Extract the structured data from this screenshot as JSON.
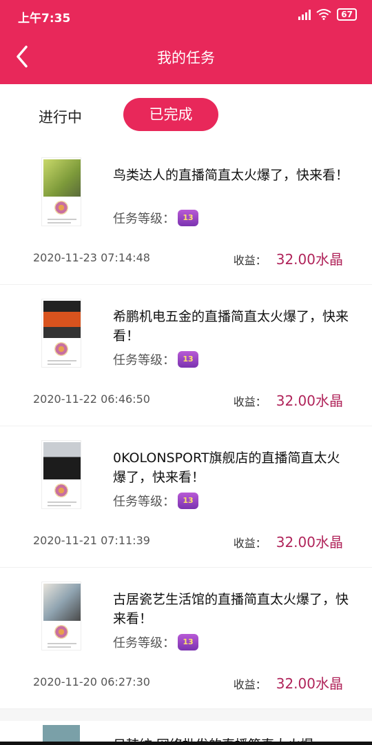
{
  "status_bar": {
    "time": "上午7:35",
    "battery": "67"
  },
  "header": {
    "title": "我的任务"
  },
  "tabs": {
    "in_progress": "进行中",
    "completed": "已完成"
  },
  "tasks": [
    {
      "title": "鸟类达人的直播简直太火爆了，快来看！",
      "level_label": "任务等级：",
      "level_badge": "13",
      "date": "2020-11-23 07:14:48",
      "earnings_label": "收益：",
      "earnings": "32.00水晶"
    },
    {
      "title": "希鹏机电五金的直播简直太火爆了，快来看！",
      "level_label": "任务等级：",
      "level_badge": "13",
      "date": "2020-11-22 06:46:50",
      "earnings_label": "收益：",
      "earnings": "32.00水晶"
    },
    {
      "title": "0KOLONSPORT旗舰店的直播简直太火爆了，快来看！",
      "level_label": "任务等级：",
      "level_badge": "13",
      "date": "2020-11-21 07:11:39",
      "earnings_label": "收益：",
      "earnings": "32.00水晶"
    },
    {
      "title": "古居瓷艺生活馆的直播简直太火爆了，快来看！",
      "level_label": "任务等级：",
      "level_badge": "13",
      "date": "2020-11-20 06:27:30",
      "earnings_label": "收益：",
      "earnings": "32.00水晶"
    }
  ],
  "partial_task": {
    "title": "日韩纺 网络批发的直播简直太火爆"
  },
  "colors": {
    "brand": "#e8285a",
    "earnings": "#b0245a"
  },
  "icons": {
    "back": "chevron-left-icon",
    "signal": "signal-icon",
    "wifi": "wifi-icon",
    "battery": "battery-icon"
  }
}
